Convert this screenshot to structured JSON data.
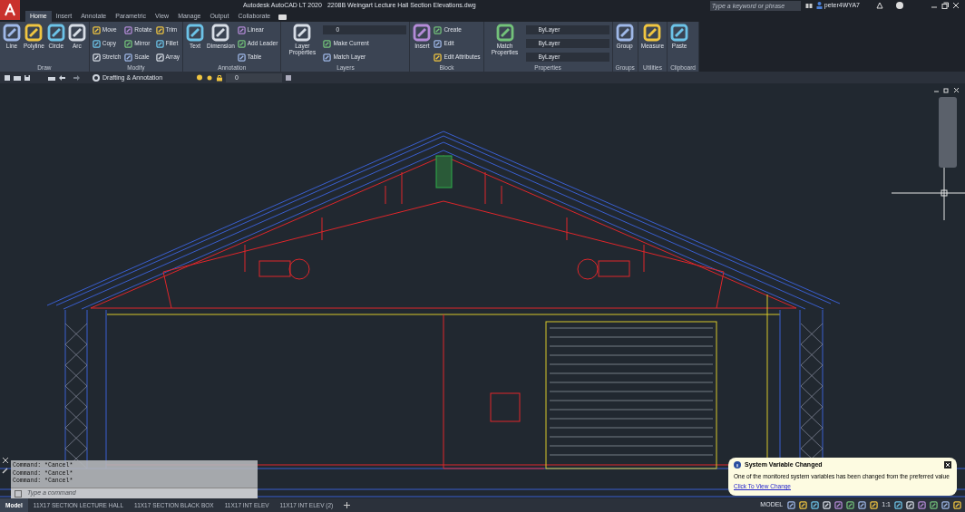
{
  "title_bar": {
    "app_title": "Autodesk AutoCAD LT 2020",
    "file_title": "2208B Weingart Lecture Hall Section Elevations.dwg",
    "search_placeholder": "Type a keyword or phrase",
    "user": "peter4WYA7"
  },
  "ribbon_tabs": [
    {
      "label": "Home",
      "selected": true
    },
    {
      "label": "Insert",
      "selected": false
    },
    {
      "label": "Annotate",
      "selected": false
    },
    {
      "label": "Parametric",
      "selected": false
    },
    {
      "label": "View",
      "selected": false
    },
    {
      "label": "Manage",
      "selected": false
    },
    {
      "label": "Output",
      "selected": false
    },
    {
      "label": "Collaborate",
      "selected": false
    }
  ],
  "panels": [
    {
      "title": "Draw",
      "tools": [
        {
          "kind": "large",
          "label": "Line"
        },
        {
          "kind": "large",
          "label": "Polyline"
        },
        {
          "kind": "large",
          "label": "Circle"
        },
        {
          "kind": "large",
          "label": "Arc"
        }
      ]
    },
    {
      "title": "Modify",
      "tools": [
        {
          "kind": "small",
          "label": "Move"
        },
        {
          "kind": "small",
          "label": "Copy"
        },
        {
          "kind": "small",
          "label": "Stretch"
        },
        {
          "kind": "small",
          "label": "Rotate"
        },
        {
          "kind": "small",
          "label": "Mirror"
        },
        {
          "kind": "small",
          "label": "Scale"
        },
        {
          "kind": "small",
          "label": "Trim"
        },
        {
          "kind": "small",
          "label": "Fillet"
        },
        {
          "kind": "small",
          "label": "Array"
        }
      ]
    },
    {
      "title": "Annotation",
      "tools": [
        {
          "kind": "large",
          "label": "Text"
        },
        {
          "kind": "large",
          "label": "Dimension"
        },
        {
          "kind": "small",
          "label": "Linear"
        },
        {
          "kind": "small",
          "label": "Add Leader"
        },
        {
          "kind": "small",
          "label": "Table"
        }
      ]
    },
    {
      "title": "Layers",
      "tools": [
        {
          "kind": "large",
          "label": "Layer Properties"
        },
        {
          "kind": "combo",
          "label": "0"
        },
        {
          "kind": "small",
          "label": "Make Current"
        },
        {
          "kind": "small",
          "label": "Match Layer"
        }
      ]
    },
    {
      "title": "Block",
      "tools": [
        {
          "kind": "large",
          "label": "Insert"
        },
        {
          "kind": "small",
          "label": "Create"
        },
        {
          "kind": "small",
          "label": "Edit"
        },
        {
          "kind": "small",
          "label": "Edit Attributes"
        }
      ]
    },
    {
      "title": "Properties",
      "tools": [
        {
          "kind": "large",
          "label": "Match Properties"
        },
        {
          "kind": "combo",
          "label": "ByLayer"
        },
        {
          "kind": "combo",
          "label": "ByLayer"
        },
        {
          "kind": "combo",
          "label": "ByLayer"
        }
      ]
    },
    {
      "title": "Groups",
      "tools": [
        {
          "kind": "large",
          "label": "Group"
        }
      ]
    },
    {
      "title": "Utilities",
      "tools": [
        {
          "kind": "large",
          "label": "Measure"
        }
      ]
    },
    {
      "title": "Clipboard",
      "tools": [
        {
          "kind": "large",
          "label": "Paste"
        }
      ]
    }
  ],
  "quick_access": {
    "workspace": "Drafting & Annotation",
    "layer": "0"
  },
  "command_window": {
    "history": [
      "Command: *Cancel*",
      "Command: *Cancel*",
      "Command: *Cancel*"
    ],
    "placeholder": "Type a command"
  },
  "layout_tabs": [
    {
      "label": "Model",
      "selected": true
    },
    {
      "label": "11X17 SECTION LECTURE HALL",
      "selected": false
    },
    {
      "label": "11X17 SECTION BLACK BOX",
      "selected": false
    },
    {
      "label": "11X17 INT ELEV",
      "selected": false
    },
    {
      "label": "11X17 INT ELEV (2)",
      "selected": false
    }
  ],
  "status_bar": {
    "mode": "MODEL",
    "scale": "1:1"
  },
  "notification": {
    "title": "System Variable Changed",
    "message": "One of the monitored system variables has been changed from the preferred value",
    "link": "Click To View Change"
  }
}
